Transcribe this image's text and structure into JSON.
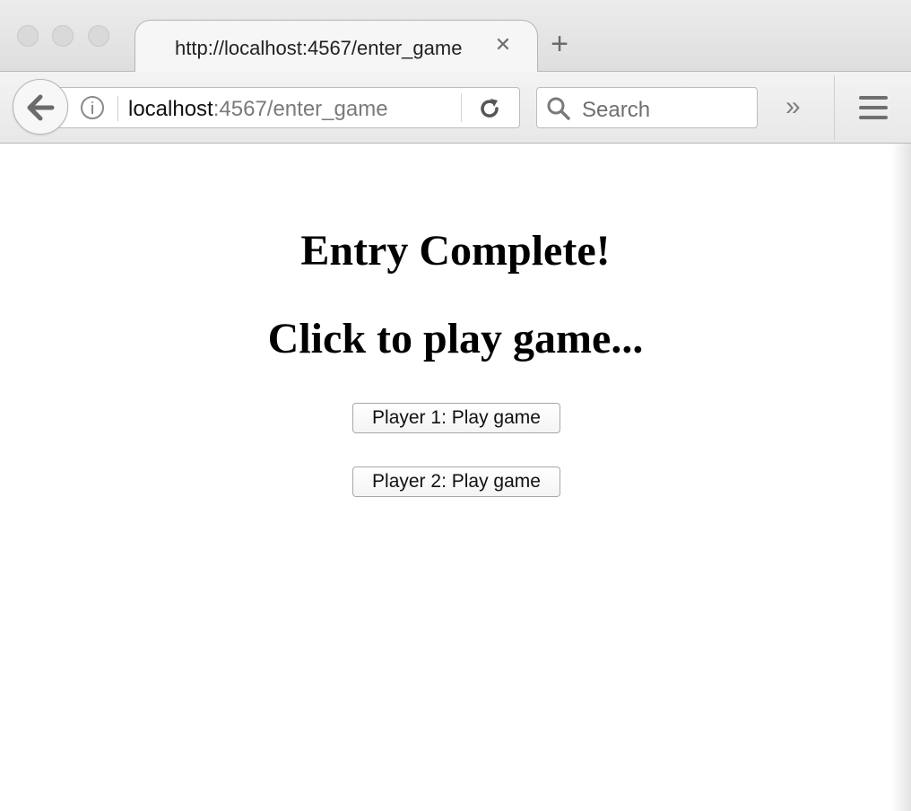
{
  "browser": {
    "tab": {
      "title": "http://localhost:4567/enter_game",
      "close_glyph": "✕"
    },
    "new_tab_glyph": "+",
    "url": {
      "host": "localhost",
      "rest": ":4567/enter_game"
    },
    "search": {
      "placeholder": "Search"
    },
    "overflow_glyph": "»"
  },
  "page": {
    "heading_1": "Entry Complete!",
    "heading_2": "Click to play game...",
    "buttons": [
      {
        "label": "Player 1: Play game"
      },
      {
        "label": "Player 2: Play game"
      }
    ]
  }
}
